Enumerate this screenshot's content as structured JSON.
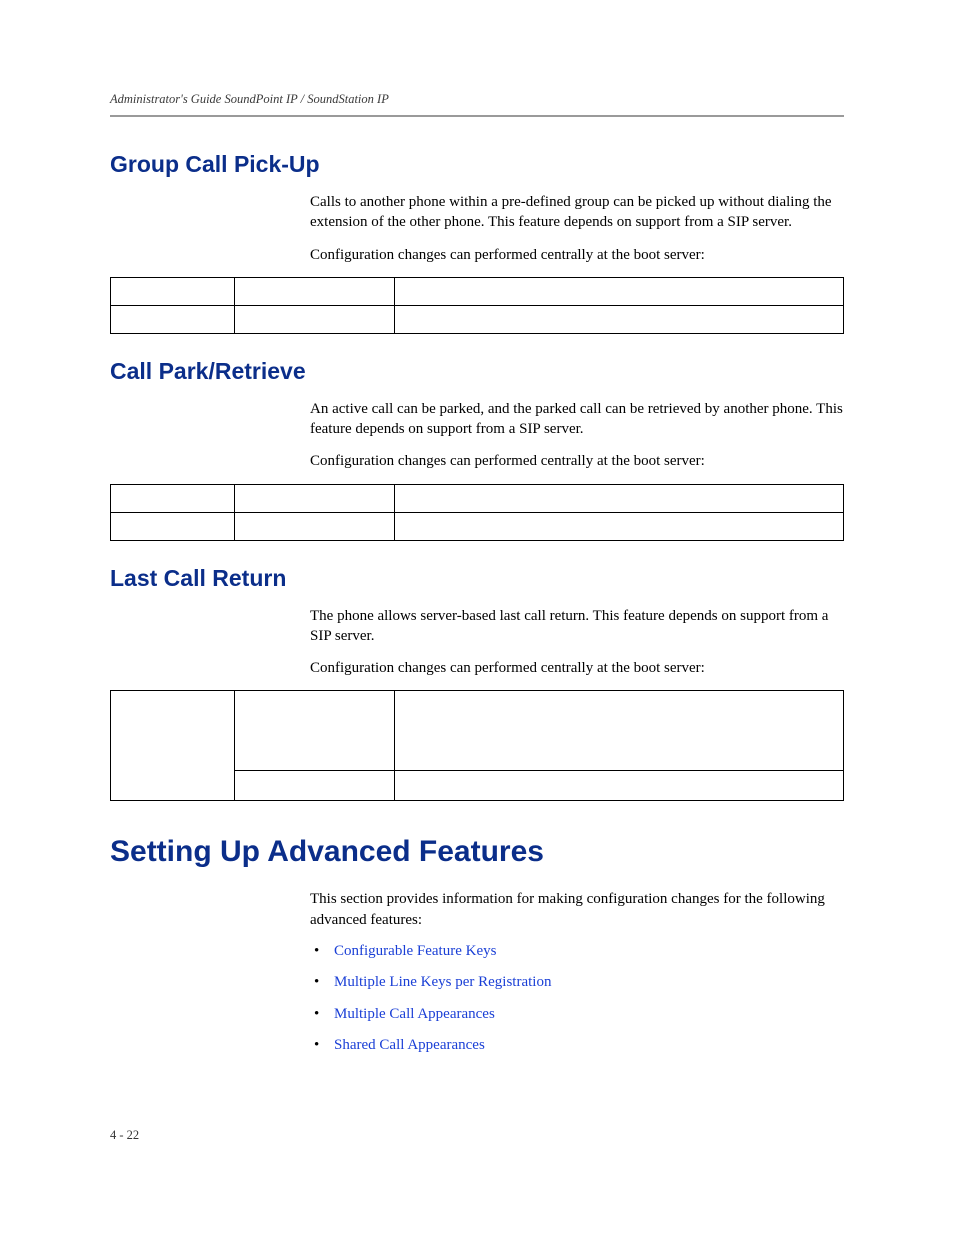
{
  "header": {
    "running_head": "Administrator's Guide SoundPoint IP / SoundStation IP"
  },
  "sections": {
    "group_call_pickup": {
      "title": "Group Call Pick-Up",
      "p1": "Calls to another phone within a pre-defined group can be picked up without dialing the extension of the other phone. This feature depends on support from a SIP server.",
      "p2": "Configuration changes can performed centrally at the boot server:"
    },
    "call_park_retrieve": {
      "title": "Call Park/Retrieve",
      "p1": "An active call can be parked, and the parked call can be retrieved by another phone. This feature depends on support from a SIP server.",
      "p2": "Configuration changes can performed centrally at the boot server:"
    },
    "last_call_return": {
      "title": "Last Call Return",
      "p1": "The phone allows server-based last call return. This feature depends on support from a SIP server.",
      "p2": "Configuration changes can performed centrally at the boot server:"
    }
  },
  "advanced": {
    "title": "Setting Up Advanced Features",
    "intro": "This section provides information for making configuration changes for the following advanced features:",
    "links": {
      "l1": "Configurable Feature Keys",
      "l2": "Multiple Line Keys per Registration",
      "l3": "Multiple Call Appearances",
      "l4": "Shared Call Appearances"
    }
  },
  "footer": {
    "page_number": "4 - 22"
  }
}
